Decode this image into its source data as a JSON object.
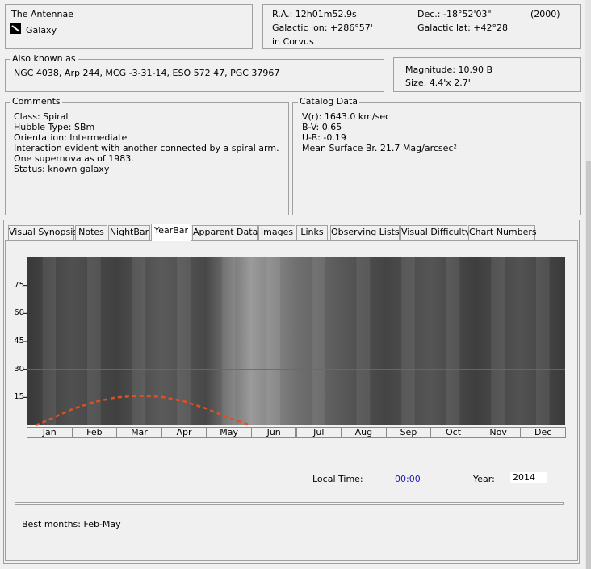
{
  "object": {
    "name": "The Antennae",
    "type": "Galaxy",
    "ra_label": "R.A.:",
    "ra": "12h01m52.9s",
    "dec_label": "Dec.:",
    "dec": "-18°52'03\"",
    "epoch": "(2000)",
    "glon_label": "Galactic lon:",
    "glon": "+286°57'",
    "glat_label": "Galactic lat:",
    "glat": "+42°28'",
    "constellation": "in Corvus"
  },
  "aka": {
    "title": "Also known as",
    "text": "NGC 4038, Arp 244, MCG -3-31-14, ESO 572 47, PGC 37967"
  },
  "magnitude": {
    "mag": "Magnitude: 10.90 B",
    "size": "Size: 4.4'x 2.7'"
  },
  "comments": {
    "title": "Comments",
    "lines": [
      "Class: Spiral",
      "Hubble Type: SBm",
      "Orientation: Intermediate",
      "Interaction evident with another connected by a spiral arm.",
      "One supernova as of 1983.",
      "Status: known galaxy"
    ]
  },
  "catalog": {
    "title": "Catalog Data",
    "lines": [
      "V(r): 1643.0 km/sec",
      "B-V: 0.65",
      "U-B: -0.19",
      "Mean Surface Br. 21.7 Mag/arcsec²"
    ]
  },
  "tabs": [
    {
      "label": "Visual Synopsis"
    },
    {
      "label": "Notes"
    },
    {
      "label": "NightBar"
    },
    {
      "label": "YearBar"
    },
    {
      "label": "Apparent Data"
    },
    {
      "label": "Images"
    },
    {
      "label": "Links"
    },
    {
      "label": "Observing Lists"
    },
    {
      "label": "Visual Difficulty"
    },
    {
      "label": "Chart Numbers"
    }
  ],
  "active_tab": "YearBar",
  "yearbar": {
    "local_time_label": "Local Time:",
    "local_time": "00:00",
    "year_label": "Year:",
    "year": "2014",
    "best_months": "Best months: Feb-May"
  },
  "chart_data": {
    "type": "line",
    "title": "",
    "xlabel": "",
    "ylabel": "",
    "categories": [
      "Jan",
      "Feb",
      "Mar",
      "Apr",
      "May",
      "Jun",
      "Jul",
      "Aug",
      "Sep",
      "Oct",
      "Nov",
      "Dec"
    ],
    "yticks": [
      15,
      30,
      45,
      60,
      75
    ],
    "ylim": [
      0,
      90
    ],
    "reference_line": 30,
    "series": [
      {
        "x": [
          0.2,
          0.5,
          1.0,
          1.5,
          2.0,
          2.5,
          3.0,
          3.5,
          4.0,
          4.5,
          5.0
        ],
        "values": [
          0,
          3,
          8.5,
          12.5,
          15,
          15.8,
          15.3,
          13,
          9,
          4,
          0
        ]
      }
    ],
    "colors": {
      "series": "#e0501e",
      "reference_line": "#1aa31a",
      "time_value": "#1a1ab4"
    },
    "grid": false,
    "legend": "none"
  }
}
